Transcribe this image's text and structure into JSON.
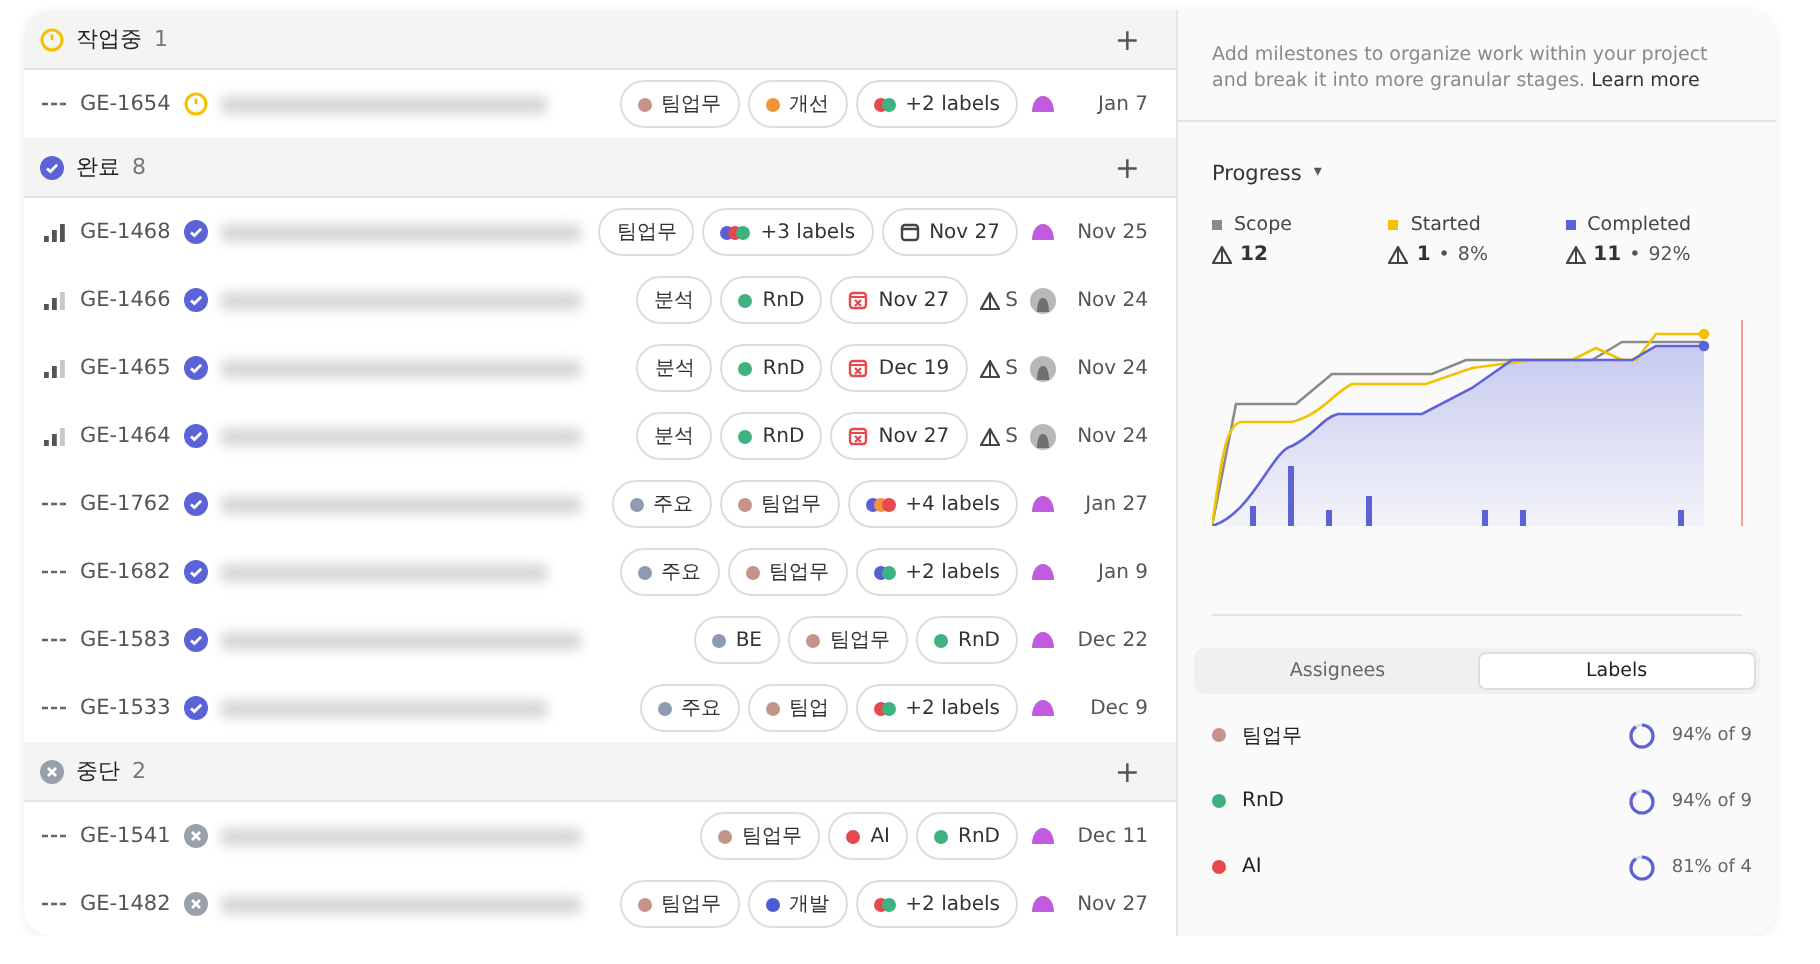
{
  "groups": [
    {
      "status_icon": {
        "kind": "started"
      },
      "name": "작업중",
      "count": "1",
      "rows": [
        {
          "priority_icon": {
            "kind": "none"
          },
          "id": "GE-1654",
          "status_icon": {
            "kind": "started"
          },
          "chips": [
            {
              "kind": "label",
              "text": "팀업무",
              "color": "#c4948a"
            },
            {
              "kind": "label",
              "text": "개선",
              "color": "#f0943a"
            },
            {
              "kind": "more",
              "text": "+2 labels",
              "dots": [
                {
                  "color": "#e5484d"
                },
                {
                  "color": "#3fb27f"
                }
              ]
            }
          ],
          "avatar": {
            "kind": "blob"
          },
          "date": "Jan 7"
        }
      ]
    },
    {
      "status_icon": {
        "kind": "done"
      },
      "name": "완료",
      "count": "8",
      "rows": [
        {
          "priority_icon": {
            "kind": "high"
          },
          "id": "GE-1468",
          "status_icon": {
            "kind": "done"
          },
          "chips": [
            {
              "kind": "plain",
              "text": "팀업무"
            },
            {
              "kind": "more",
              "text": "+3 labels",
              "dots": [
                {
                  "color": "#5b5fd6"
                },
                {
                  "color": "#e5484d"
                },
                {
                  "color": "#3fb27f"
                }
              ]
            },
            {
              "kind": "target",
              "text": "Nov 27"
            }
          ],
          "avatar": {
            "kind": "blob"
          },
          "date": "Nov 25"
        },
        {
          "priority_icon": {
            "kind": "medium"
          },
          "id": "GE-1466",
          "status_icon": {
            "kind": "done"
          },
          "chips": [
            {
              "kind": "plain",
              "text": "분석"
            },
            {
              "kind": "label",
              "text": "RnD",
              "color": "#3fb27f"
            },
            {
              "kind": "due",
              "text": "Nov 27"
            }
          ],
          "estimate": "S",
          "avatar": {
            "kind": "photo"
          },
          "date": "Nov 24"
        },
        {
          "priority_icon": {
            "kind": "medium"
          },
          "id": "GE-1465",
          "status_icon": {
            "kind": "done"
          },
          "chips": [
            {
              "kind": "plain",
              "text": "분석"
            },
            {
              "kind": "label",
              "text": "RnD",
              "color": "#3fb27f"
            },
            {
              "kind": "due",
              "text": "Dec 19"
            }
          ],
          "estimate": "S",
          "avatar": {
            "kind": "photo"
          },
          "date": "Nov 24"
        },
        {
          "priority_icon": {
            "kind": "medium"
          },
          "id": "GE-1464",
          "status_icon": {
            "kind": "done"
          },
          "chips": [
            {
              "kind": "plain",
              "text": "분석"
            },
            {
              "kind": "label",
              "text": "RnD",
              "color": "#3fb27f"
            },
            {
              "kind": "due",
              "text": "Nov 27"
            }
          ],
          "estimate": "S",
          "avatar": {
            "kind": "photo"
          },
          "date": "Nov 24"
        },
        {
          "priority_icon": {
            "kind": "none"
          },
          "id": "GE-1762",
          "status_icon": {
            "kind": "done"
          },
          "chips": [
            {
              "kind": "label",
              "text": "주요",
              "color": "#8e9bb0"
            },
            {
              "kind": "label",
              "text": "팀업무",
              "color": "#c4948a"
            },
            {
              "kind": "more",
              "text": "+4 labels",
              "dots": [
                {
                  "color": "#5b5fd6"
                },
                {
                  "color": "#f0943a"
                },
                {
                  "color": "#e5484d"
                }
              ]
            }
          ],
          "avatar": {
            "kind": "blob"
          },
          "date": "Jan 27"
        },
        {
          "priority_icon": {
            "kind": "none"
          },
          "id": "GE-1682",
          "status_icon": {
            "kind": "done"
          },
          "chips": [
            {
              "kind": "label",
              "text": "주요",
              "color": "#8e9bb0"
            },
            {
              "kind": "label",
              "text": "팀업무",
              "color": "#c4948a"
            },
            {
              "kind": "more",
              "text": "+2 labels",
              "dots": [
                {
                  "color": "#5b5fd6"
                },
                {
                  "color": "#3fb27f"
                }
              ]
            }
          ],
          "avatar": {
            "kind": "blob"
          },
          "date": "Jan 9"
        },
        {
          "priority_icon": {
            "kind": "none"
          },
          "id": "GE-1583",
          "status_icon": {
            "kind": "done"
          },
          "chips": [
            {
              "kind": "label",
              "text": "BE",
              "color": "#8e9bb0"
            },
            {
              "kind": "label",
              "text": "팀업무",
              "color": "#c4948a"
            },
            {
              "kind": "label",
              "text": "RnD",
              "color": "#3fb27f"
            }
          ],
          "avatar": {
            "kind": "blob"
          },
          "date": "Dec 22"
        },
        {
          "priority_icon": {
            "kind": "none"
          },
          "id": "GE-1533",
          "status_icon": {
            "kind": "done"
          },
          "chips": [
            {
              "kind": "label",
              "text": "주요",
              "color": "#8e9bb0"
            },
            {
              "kind": "label",
              "text": "팀업",
              "color": "#c4948a"
            },
            {
              "kind": "more",
              "text": "+2 labels",
              "dots": [
                {
                  "color": "#e5484d"
                },
                {
                  "color": "#3fb27f"
                }
              ]
            }
          ],
          "avatar": {
            "kind": "blob"
          },
          "date": "Dec 9"
        }
      ]
    },
    {
      "status_icon": {
        "kind": "canceled"
      },
      "name": "중단",
      "count": "2",
      "rows": [
        {
          "priority_icon": {
            "kind": "none"
          },
          "id": "GE-1541",
          "status_icon": {
            "kind": "canceled"
          },
          "chips": [
            {
              "kind": "label",
              "text": "팀업무",
              "color": "#c4948a"
            },
            {
              "kind": "label",
              "text": "AI",
              "color": "#e5484d"
            },
            {
              "kind": "label",
              "text": "RnD",
              "color": "#3fb27f"
            }
          ],
          "avatar": {
            "kind": "blob"
          },
          "date": "Dec 11"
        },
        {
          "priority_icon": {
            "kind": "none"
          },
          "id": "GE-1482",
          "status_icon": {
            "kind": "canceled"
          },
          "chips": [
            {
              "kind": "label",
              "text": "팀업무",
              "color": "#c4948a"
            },
            {
              "kind": "label",
              "text": "개발",
              "color": "#4a5bd6"
            },
            {
              "kind": "more",
              "text": "+2 labels",
              "dots": [
                {
                  "color": "#e5484d"
                },
                {
                  "color": "#3fb27f"
                }
              ]
            }
          ],
          "avatar": {
            "kind": "blob"
          },
          "date": "Nov 27"
        }
      ]
    }
  ],
  "add_symbol": "+",
  "panel": {
    "intro": "Add milestones to organize work within your project and break it into more granular stages.",
    "learn_more": "Learn more",
    "progress_menu": "Progress",
    "menu_caret": "▾",
    "legend": [
      {
        "name": "Scope",
        "color": "#8a8a8a",
        "count": "12"
      },
      {
        "name": "Started",
        "color": "#f2c200",
        "count": "1",
        "separator": "•",
        "percent": "8%"
      },
      {
        "name": "Completed",
        "color": "#5b63d6",
        "count": "11",
        "separator": "•",
        "percent": "92%"
      }
    ],
    "tabs": [
      {
        "label": "Assignees",
        "selected": false
      },
      {
        "label": "Labels",
        "selected": true
      }
    ],
    "labels": [
      {
        "name": "팀업무",
        "color": "#c4948a",
        "reading": "94% of 9"
      },
      {
        "name": "RnD",
        "color": "#3fb27f",
        "reading": "94% of 9"
      },
      {
        "name": "AI",
        "color": "#e5484d",
        "reading": "81% of 4"
      }
    ]
  }
}
